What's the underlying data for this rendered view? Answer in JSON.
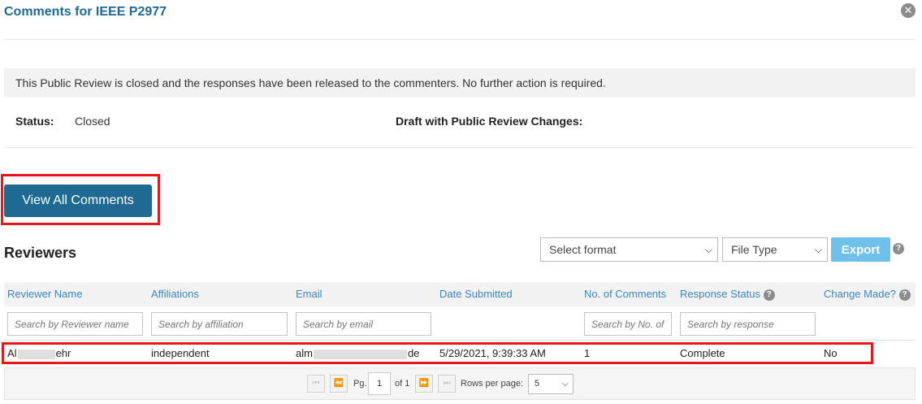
{
  "header": {
    "title": "Comments for IEEE P2977",
    "close_symbol": "✕"
  },
  "notice": "This Public Review is closed and the responses have been released to the commenters. No further action is required.",
  "status": {
    "label": "Status:",
    "value": "Closed",
    "draft_label": "Draft with Public Review Changes:"
  },
  "view_all_button": "View All Comments",
  "reviewers": {
    "title": "Reviewers",
    "format_select": "Select format",
    "file_type_select": "File Type",
    "export_label": "Export",
    "columns": [
      "Reviewer Name",
      "Affiliations",
      "Email",
      "Date Submitted",
      "No. of Comments",
      "Response Status",
      "Change Made?"
    ],
    "filters": {
      "name": "Search by Reviewer name",
      "affiliation": "Search by affiliation",
      "email": "Search by email",
      "comments": "Search by No. of comments",
      "response": "Search by response"
    },
    "rows": [
      {
        "name_start": "Al",
        "name_end": "ehr",
        "affiliation": "independent",
        "email_start": "alm",
        "email_end": "de",
        "date": "5/29/2021, 9:39:33 AM",
        "comments": "1",
        "response": "Complete",
        "change_made": "No"
      }
    ]
  },
  "pager": {
    "page_label": "Pg.",
    "page_value": "1",
    "of_label": "of 1",
    "rows_per_page_label": "Rows per page:",
    "rows_per_page_value": "5"
  },
  "colors": {
    "brand": "#1f6a93",
    "link": "#3b86b8",
    "highlight": "#e8161b",
    "export": "#6fc0ea"
  }
}
